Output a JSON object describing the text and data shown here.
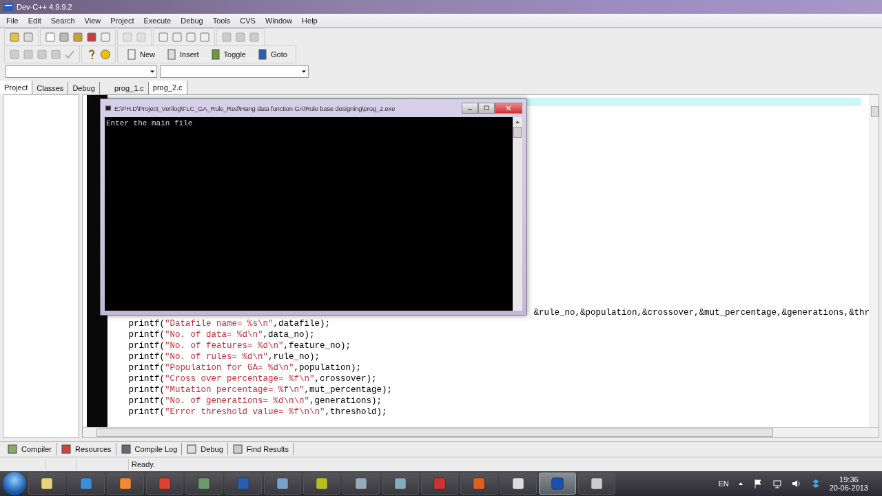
{
  "window": {
    "title": "Dev-C++ 4.9.9.2"
  },
  "menu": [
    "File",
    "Edit",
    "Search",
    "View",
    "Project",
    "Execute",
    "Debug",
    "Tools",
    "CVS",
    "Window",
    "Help"
  ],
  "toolbar_buttons": [
    "New",
    "Insert",
    "Toggle",
    "Goto"
  ],
  "left_tabs": [
    {
      "label": "Project",
      "selected": true
    },
    {
      "label": "Classes",
      "selected": false
    },
    {
      "label": "Debug",
      "selected": false
    }
  ],
  "file_tabs": [
    {
      "label": "prog_1.c",
      "selected": false
    },
    {
      "label": "prog_2.c",
      "selected": true
    }
  ],
  "console": {
    "title": "E:\\PH.D\\Project_Verilog\\FLC_GA_Rule_Red\\Hang data function GA\\Rule base designing\\prog_2.exe",
    "output": "Enter the main file"
  },
  "code_lines": [
    {
      "kind": "covered",
      "text": "&rule_no,&population,&crossover,&mut_percentage,&generations,&thr"
    },
    {
      "kind": "code",
      "text": "printf(\"Datafile name= %s\\n\",datafile);"
    },
    {
      "kind": "code",
      "text": "printf(\"No. of data= %d\\n\",data_no);"
    },
    {
      "kind": "code",
      "text": "printf(\"No. of features= %d\\n\",feature_no);"
    },
    {
      "kind": "code",
      "text": "printf(\"No. of rules= %d\\n\",rule_no);"
    },
    {
      "kind": "code",
      "text": "printf(\"Population for GA= %d\\n\",population);"
    },
    {
      "kind": "code",
      "text": "printf(\"Cross over percentage= %f\\n\",crossover);"
    },
    {
      "kind": "code",
      "text": "printf(\"Mutation percentage= %f\\n\",mut_percentage);"
    },
    {
      "kind": "code",
      "text": "printf(\"No. of generations= %d\\n\\n\",generations);"
    },
    {
      "kind": "code",
      "text": "printf(\"Error threshold value= %f\\n\\n\",threshold);"
    }
  ],
  "bottom_tabs": [
    "Compiler",
    "Resources",
    "Compile Log",
    "Debug",
    "Find Results"
  ],
  "status": "Ready.",
  "tray": {
    "language": "EN",
    "time": "19:36",
    "date": "20-06-2013"
  }
}
